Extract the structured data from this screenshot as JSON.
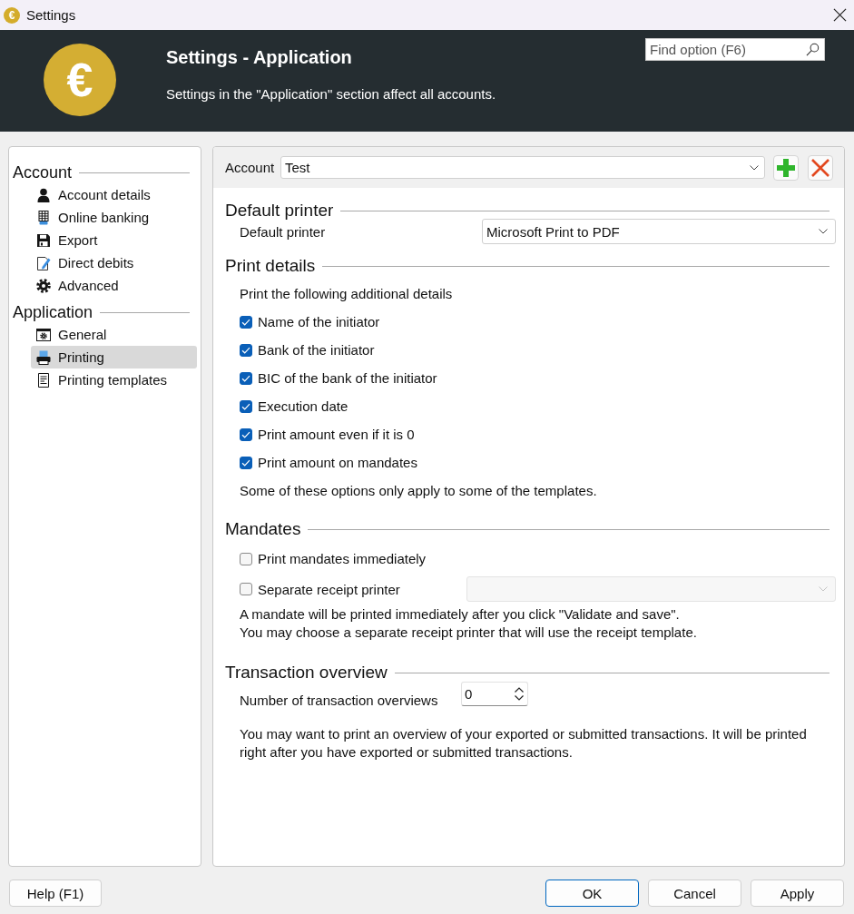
{
  "window": {
    "icon_glyph": "€",
    "title": "Settings"
  },
  "header": {
    "logo_glyph": "€",
    "title": "Settings - Application",
    "subtitle": "Settings in the \"Application\" section affect all accounts.",
    "search": {
      "placeholder": "Find option (F6)"
    }
  },
  "sidebar": {
    "groups": [
      {
        "label": "Account",
        "items": [
          {
            "label": "Account details",
            "selected": false
          },
          {
            "label": "Online banking",
            "selected": false
          },
          {
            "label": "Export",
            "selected": false
          },
          {
            "label": "Direct debits",
            "selected": false
          },
          {
            "label": "Advanced",
            "selected": false
          }
        ]
      },
      {
        "label": "Application",
        "items": [
          {
            "label": "General",
            "selected": false
          },
          {
            "label": "Printing",
            "selected": true
          },
          {
            "label": "Printing templates",
            "selected": false
          }
        ]
      }
    ]
  },
  "account_bar": {
    "label": "Account",
    "value": "Test"
  },
  "sections": [
    {
      "title": "Default printer",
      "items": [
        {
          "kind": "select",
          "label": "Default printer",
          "value": "Microsoft Print to PDF",
          "disabled": false
        }
      ]
    },
    {
      "title": "Print details",
      "items": [
        {
          "kind": "text",
          "text": "Print the following additional details"
        },
        {
          "kind": "checkbox",
          "label": "Name of the initiator",
          "checked": true
        },
        {
          "kind": "checkbox",
          "label": "Bank of the initiator",
          "checked": true
        },
        {
          "kind": "checkbox",
          "label": "BIC of the bank of the initiator",
          "checked": true
        },
        {
          "kind": "checkbox",
          "label": "Execution date",
          "checked": true
        },
        {
          "kind": "checkbox",
          "label": "Print amount even if it is 0",
          "checked": true
        },
        {
          "kind": "checkbox",
          "label": "Print amount on mandates",
          "checked": true
        },
        {
          "kind": "text",
          "text": "Some of these options only apply to some of the templates."
        }
      ]
    },
    {
      "title": "Mandates",
      "items": [
        {
          "kind": "checkbox",
          "label": "Print mandates immediately",
          "checked": false
        },
        {
          "kind": "checkbox_select",
          "label": "Separate receipt printer",
          "checked": false,
          "select": {
            "disabled": true
          }
        },
        {
          "kind": "note",
          "lines": [
            "A mandate will be printed immediately after you click \"Validate and save\".",
            "You may choose a separate receipt printer that will use the receipt template."
          ]
        }
      ]
    },
    {
      "title": "Transaction overview",
      "items": [
        {
          "kind": "spinner",
          "label": "Number of transaction overviews",
          "value": "0"
        },
        {
          "kind": "paragraph",
          "text": "You may want to print an overview of your exported or submitted transactions. It will be printed right after you have exported or submitted transactions."
        }
      ]
    }
  ],
  "footer": {
    "left_buttons": [
      {
        "label": "Help (F1)",
        "default": false
      }
    ],
    "right_buttons": [
      {
        "label": "OK",
        "default": true
      },
      {
        "label": "Cancel",
        "default": false
      },
      {
        "label": "Apply",
        "default": false
      }
    ]
  }
}
